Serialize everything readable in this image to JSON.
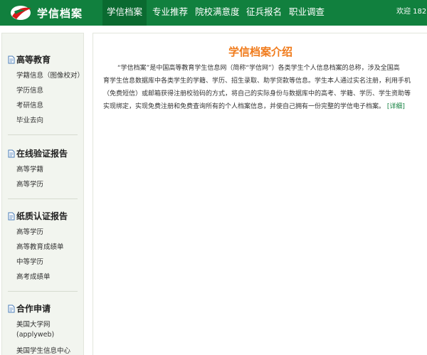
{
  "header": {
    "logo_text": "学信档案",
    "nav": [
      {
        "label": "学信档案",
        "active": true
      },
      {
        "label": "专业推荐",
        "active": false
      },
      {
        "label": "院校满意度",
        "active": false
      },
      {
        "label": "征兵报名",
        "active": false
      },
      {
        "label": "职业调查",
        "active": false
      }
    ],
    "welcome": "欢迎 182"
  },
  "sidebar": {
    "sections": [
      {
        "title": "高等教育",
        "items": [
          "学籍信息（图像校对）",
          "学历信息",
          "考研信息",
          "毕业去向"
        ]
      },
      {
        "title": "在线验证报告",
        "items": [
          "高等学籍",
          "高等学历"
        ]
      },
      {
        "title": "纸质认证报告",
        "items": [
          "高等学历",
          "高等教育成绩单",
          "中等学历",
          "高考成绩单"
        ]
      },
      {
        "title": "合作申请",
        "items": [
          "美国大学网",
          "(applyweb)",
          "美国学生信息中心"
        ]
      }
    ]
  },
  "main": {
    "title": "学信档案介绍",
    "intro_lines": [
      "“学信档案”是中国高等教育学生信息网（简称“学信网”）各类学生个人信息档案的总称，涉及全国高",
      "育学生信息数据库中各类学生的学籍、学历、招生录取、助学贷款等信息。学生本人通过实名注册，利用手机",
      "（免费短信）或邮箱获得注册校验码的方式，将自己的实际身份与数据库中的高考、学籍、学历、学生资助等",
      "实现绑定，实现免费注册和免费查询所有的个人档案信息，并使自己拥有一份完整的学信电子档案。"
    ],
    "detail_link": "[详细]"
  },
  "colors": {
    "brand_green": "#11803e",
    "title_orange": "#f07a1a",
    "sidebar_bg": "#f2f5ef"
  }
}
